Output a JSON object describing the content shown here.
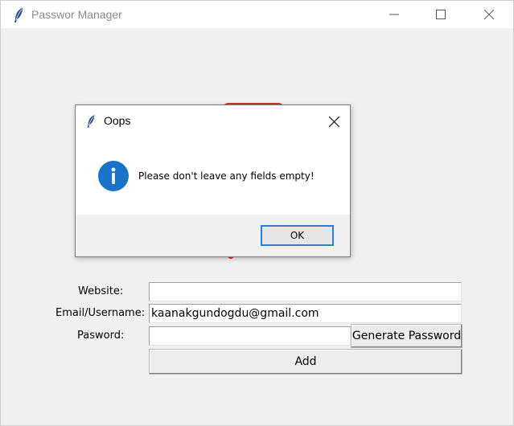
{
  "window": {
    "title": "Passwor Manager",
    "app_icon": "feather-icon"
  },
  "form": {
    "website_label": "Website:",
    "website_value": "",
    "email_label": "Email/Username:",
    "email_value": "kaanakgundogdu@gmail.com",
    "password_label": "Pasword:",
    "password_value": "",
    "generate_button": "Generate Password",
    "add_button": "Add"
  },
  "dialog": {
    "title": "Oops",
    "icon": "info-icon",
    "message": "Please don't leave any fields empty!",
    "ok_button": "OK"
  },
  "colors": {
    "info_blue": "#1a73c8",
    "focus_border": "#2c7fd1",
    "logo_red": "#c0392b"
  }
}
